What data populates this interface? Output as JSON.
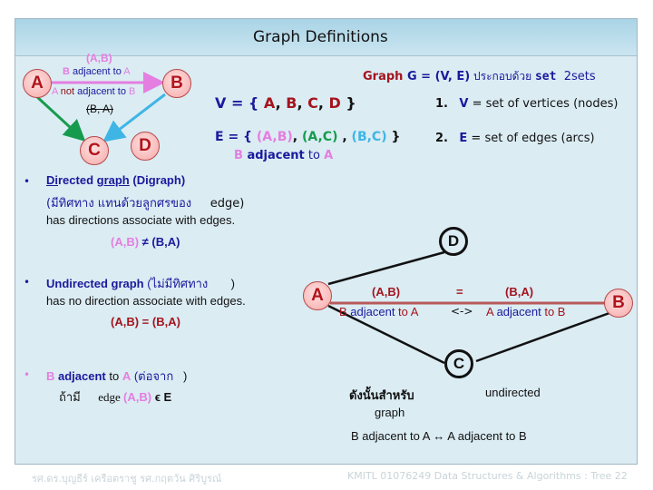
{
  "title": "Graph Definitions",
  "directed_diagram": {
    "nodes": [
      "A",
      "B",
      "C",
      "D"
    ],
    "edge_label_top": "(A,B)",
    "b_adj_a": {
      "b": "B",
      "text": " adjacent to ",
      "a": "A"
    },
    "a_not_adj_b": {
      "a": "A",
      "not": " not ",
      "text": "adjacent to ",
      "b": "B"
    },
    "struck_pair": "(B, A)"
  },
  "graph_def": {
    "graph_word": "Graph",
    "g_eq": " G = ",
    "ve": "(V, E)",
    "thai": " ประกอบด้วย ",
    "set_word": "set",
    "two_sets": "2sets"
  },
  "vertex_set": {
    "label": "V = { ",
    "members": [
      "A",
      "B",
      "C",
      "D"
    ],
    "close": " }"
  },
  "edge_set": {
    "label": "E = { ",
    "e1": "(A,B)",
    "e2": "(A,C)",
    "e3": "(B,C)",
    "close": " }",
    "note_b": "B",
    "note_adj": " adjacent",
    "note_to": " to ",
    "note_a": "A"
  },
  "numbered": [
    {
      "num": "1.",
      "var": "V",
      "text": " = set of vertices (nodes)"
    },
    {
      "num": "2.",
      "var": "E",
      "text": " = set of edges (arcs)"
    }
  ],
  "directed": {
    "heading_di": "Di",
    "heading_rected": "rected ",
    "heading_graph": "graph",
    "heading_paren": "  (Digraph)",
    "thai_line": "(มีทิศทาง     แทนด้วยลูกศรของ",
    "thai_edge": "edge)",
    "desc": "has directions associate with edges.",
    "ab": "(A,B)",
    "neq": " ≠ ",
    "ba": "(B,A)"
  },
  "undirected": {
    "heading": "Undirected graph",
    "thai": " (ไม่มีทิศทาง",
    "close": ")",
    "desc": "has no direction associate with edges.",
    "eq_line": "(A,B) = (B,A)"
  },
  "adjacency": {
    "b": "B",
    "adjacent": " adjacent",
    "to": " to ",
    "a": "A",
    "thai": " (ต่อจาก",
    "close": ")",
    "line2_thai": "ถ้ามี",
    "line2_edge": "edge ",
    "line2_pair": "(A,B)",
    "line2_in": " ϵ E"
  },
  "undirected_diagram": {
    "nodes": [
      "A",
      "B",
      "C",
      "D"
    ],
    "ab": "(A,B)",
    "eq": "=",
    "ba": "(B,A)",
    "left_b": "B",
    "left_text": " adjacent",
    "left_to": " to A",
    "arrow": "<->",
    "right_a": "A",
    "right_text": " adjacent",
    "right_to": " to B"
  },
  "note": {
    "thai": "ดังนั้นสำหรับ",
    "undirected": "undirected",
    "graph": "graph",
    "equiv": "B adjacent to A ↔ A adjacent to B"
  },
  "footer": {
    "authors": "รศ.ดร.บุญธีร์     เครือตราชู     รศ.กฤตวัน   ศิริบูรณ์",
    "course": "KMITL    01076249 Data Structures & Algorithms : Tree 22"
  },
  "colors": {
    "panel_bg": "#dbecf3",
    "header_bg": "#a9d4e6",
    "navy": "#1a1a9c",
    "red": "#a4141d",
    "pink": "#e47ee0",
    "green": "#169b4e",
    "cyan": "#3fb5e5"
  }
}
